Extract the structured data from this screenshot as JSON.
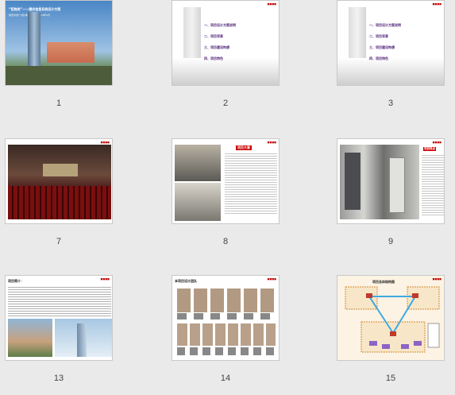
{
  "slides": [
    {
      "num": "1",
      "title": "“招商府”——德庆信息系统设计方案",
      "subtitle": "肇庆市德广(德)律师事务所 2014年4月"
    },
    {
      "num": "2",
      "menu": [
        "一、项目设计方案说明",
        "二、项目背景",
        "三、项目建设构想",
        "四、项目特色"
      ]
    },
    {
      "num": "3",
      "menu": [
        "一、项目设计方案说明",
        "二、项目背景",
        "三、项目建设构想",
        "四、项目特色"
      ]
    },
    {
      "num": "7"
    },
    {
      "num": "8",
      "heading": "项目大事"
    },
    {
      "num": "9",
      "heading": "项目特点"
    },
    {
      "num": "13",
      "heading": "项目简介："
    },
    {
      "num": "14",
      "heading": "本项目设计团队"
    },
    {
      "num": "15",
      "heading": "项目总体结构图"
    }
  ],
  "colors": {
    "accent": "#52267a",
    "highlight": "#cc0000",
    "background": "#eaeaea"
  }
}
